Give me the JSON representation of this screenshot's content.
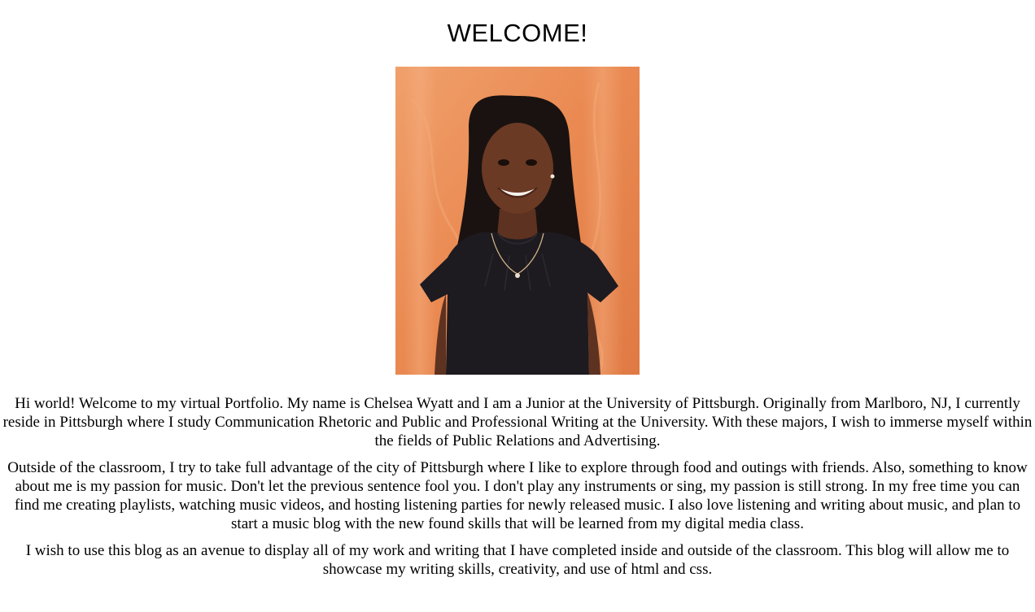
{
  "page": {
    "heading": "WELCOME!",
    "photo_subject": "portrait-photo",
    "paragraphs": [
      "Hi world! Welcome to my virtual Portfolio. My name is Chelsea Wyatt and I am a Junior at the University of Pittsburgh. Originally from Marlboro, NJ, I currently reside in Pittsburgh where I study Communication Rhetoric and Public and Professional Writing at the University. With these majors, I wish to immerse myself within the fields of Public Relations and Advertising.",
      "Outside of the classroom, I try to take full advantage of the city of Pittsburgh where I like to explore through food and outings with friends. Also, something to know about me is my passion for music. Don't let the previous sentence fool you. I don't play any instruments or sing, my passion is still strong. In my free time you can find me creating playlists, watching music videos, and hosting listening parties for newly released music. I also love listening and writing about music, and plan to start a music blog with the new found skills that will be learned from my digital media class.",
      "I wish to use this blog as an avenue to display all of my work and writing that I have completed inside and outside of the classroom. This blog will allow me to showcase my writing skills, creativity, and use of html and css."
    ]
  },
  "colors": {
    "background": "#ffffff",
    "text": "#000000",
    "photo_backdrop": "#e8844f",
    "photo_backdrop_light": "#f3a774",
    "top": "#1d1b20",
    "skin": "#6b3a25",
    "hair": "#1a1210"
  }
}
